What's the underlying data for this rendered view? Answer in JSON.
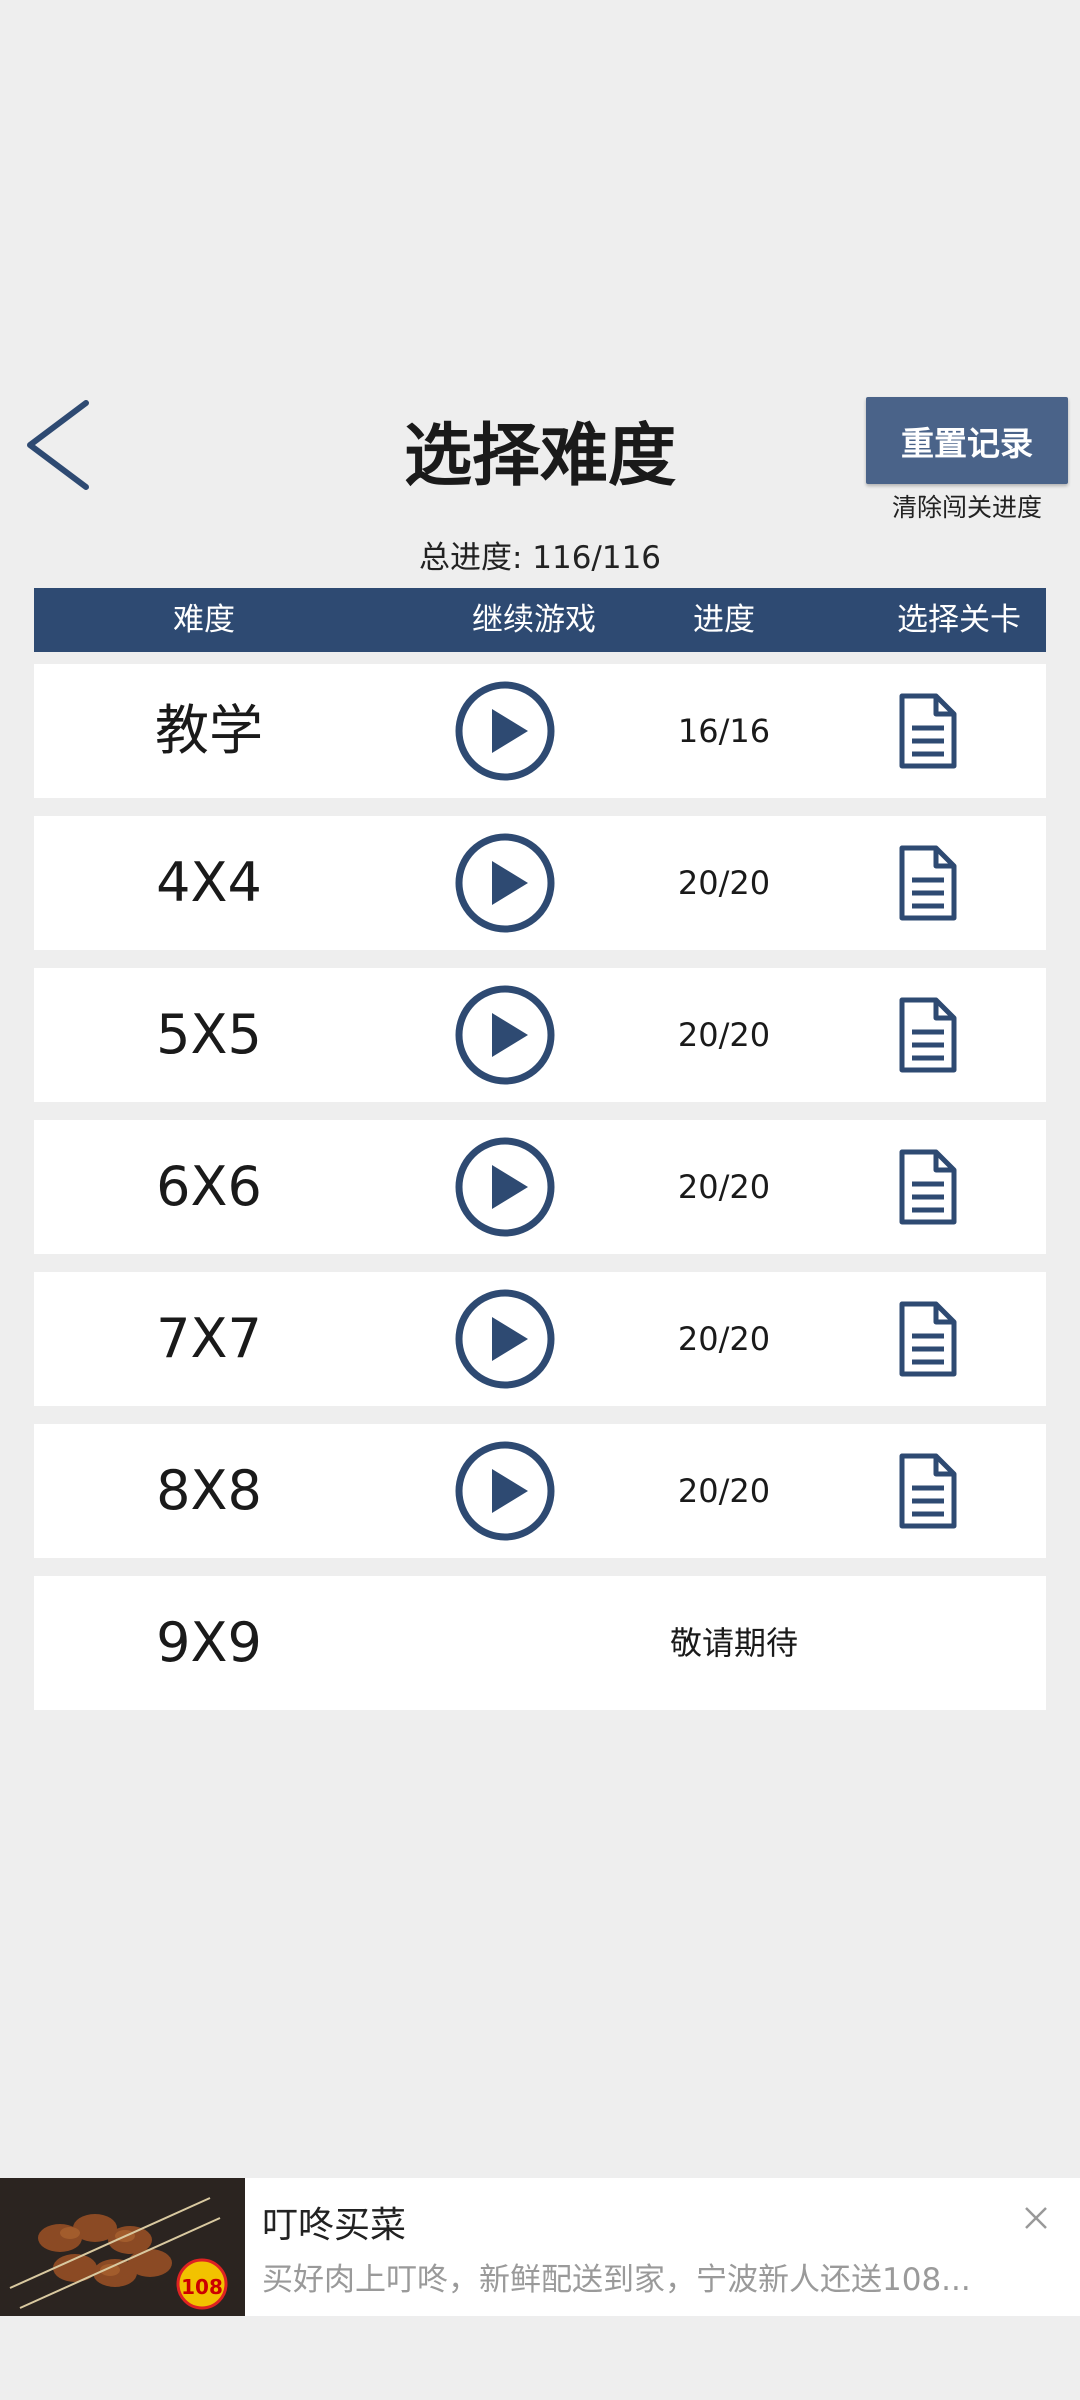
{
  "header": {
    "title": "选择难度",
    "back_icon": "chevron-left-icon",
    "reset_button_label": "重置记录",
    "reset_subtitle": "清除闯关进度",
    "total_progress": "总进度: 116/116"
  },
  "table": {
    "columns": [
      "难度",
      "继续游戏",
      "进度",
      "选择关卡"
    ],
    "rows": [
      {
        "name": "教学",
        "progress": "16/16"
      },
      {
        "name": "4X4",
        "progress": "20/20"
      },
      {
        "name": "5X5",
        "progress": "20/20"
      },
      {
        "name": "6X6",
        "progress": "20/20"
      },
      {
        "name": "7X7",
        "progress": "20/20"
      },
      {
        "name": "8X8",
        "progress": "20/20"
      }
    ],
    "locked_row": {
      "name": "9X9",
      "status": "敬请期待"
    }
  },
  "ad": {
    "title": "叮咚买菜",
    "description": "买好肉上叮咚，新鲜配送到家，宁波新人还送108...",
    "image_badge": "108"
  },
  "colors": {
    "accent": "#2e4a72",
    "reset_button": "#4a6389",
    "background": "#eeeeee"
  }
}
